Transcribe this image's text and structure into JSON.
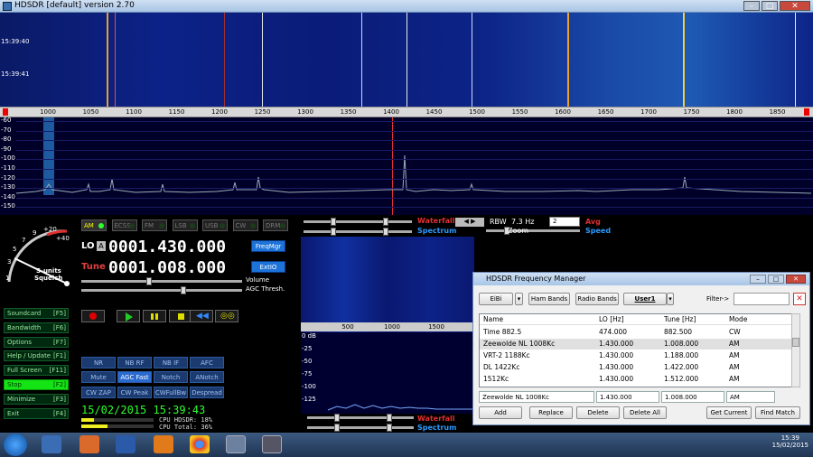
{
  "window": {
    "title": "HDSDR [default]  version 2.70"
  },
  "waterfall": {
    "times": [
      "15:39:40",
      "15:39:41"
    ]
  },
  "freq_scale": {
    "ticks": [
      "1000",
      "1050",
      "1100",
      "1150",
      "1200",
      "1250",
      "1300",
      "1350",
      "1400",
      "1450",
      "1500",
      "1550",
      "1600",
      "1650",
      "1700",
      "1750",
      "1800",
      "1850"
    ]
  },
  "spectrum": {
    "db_labels": [
      "-60",
      "-70",
      "-80",
      "-90",
      "-100",
      "-110",
      "-120",
      "-130",
      "-140",
      "-150"
    ]
  },
  "smeter": {
    "scale": [
      "1",
      "3",
      "5",
      "7",
      "9",
      "+20",
      "+40"
    ],
    "title": "S-units",
    "sub": "Squelch"
  },
  "modes": [
    {
      "label": "AM",
      "on": true
    },
    {
      "label": "ECSS",
      "on": false
    },
    {
      "label": "FM",
      "on": false
    },
    {
      "label": "LSB",
      "on": false
    },
    {
      "label": "USB",
      "on": false
    },
    {
      "label": "CW",
      "on": false
    },
    {
      "label": "DRM",
      "on": false
    }
  ],
  "lo": {
    "label": "LO",
    "badge": "A",
    "value": "0001.430.000"
  },
  "tune": {
    "label": "Tune",
    "value": "0001.008.000"
  },
  "buttons": {
    "freqmgr": "FreqMgr",
    "extio": "ExtIO"
  },
  "sliders": {
    "volume": "Volume",
    "agc": "AGC Thresh."
  },
  "side_buttons": [
    {
      "label": "Soundcard",
      "key": "[F5]"
    },
    {
      "label": "Bandwidth",
      "key": "[F6]"
    },
    {
      "label": "Options",
      "key": "[F7]"
    },
    {
      "label": "Help / Update",
      "key": "[F1]"
    },
    {
      "label": "Full Screen",
      "key": "[F11]"
    },
    {
      "label": "Stop",
      "key": "[F2]"
    },
    {
      "label": "Minimize",
      "key": "[F3]"
    },
    {
      "label": "Exit",
      "key": "[F4]"
    }
  ],
  "dsp_row1": [
    "NR",
    "NB RF",
    "NB IF",
    "AFC"
  ],
  "dsp_row2": [
    "Mute",
    "AGC Fast",
    "Notch",
    "ANotch"
  ],
  "dsp_row3": [
    "CW ZAP",
    "CW Peak",
    "CWFullBw",
    "Despread"
  ],
  "datetime": "15/02/2015 15:39:43",
  "cpu": {
    "hdsdr": "CPU HDSDR: 18%",
    "total": "CPU Total: 36%",
    "hdsdr_level": 0.18,
    "total_level": 0.36
  },
  "controls": {
    "waterfall": "Waterfall",
    "spectrum": "Spectrum",
    "rbw_label": "RBW",
    "rbw_value": "7.3 Hz",
    "zoom": "Zoom",
    "avg": "Avg",
    "speed": "Speed",
    "avg_value": "2"
  },
  "sub_scale": [
    "500",
    "1000",
    "1500"
  ],
  "sub_db": [
    "0 dB",
    "-25",
    "-50",
    "-75",
    "-100",
    "-125"
  ],
  "fm": {
    "title": "HDSDR Frequency Manager",
    "tabs": [
      "EiBi",
      "Ham Bands",
      "Radio Bands",
      "User1"
    ],
    "filter_label": "Filter->",
    "columns": [
      "Name",
      "LO [Hz]",
      "Tune [Hz]",
      "Mode"
    ],
    "rows": [
      [
        "Time 882.5",
        "474.000",
        "882.500",
        "CW"
      ],
      [
        "Zeewolde NL 1008Kc",
        "1.430.000",
        "1.008.000",
        "AM"
      ],
      [
        "VRT-2 1188Kc",
        "1.430.000",
        "1.188.000",
        "AM"
      ],
      [
        "DL 1422Kc",
        "1.430.000",
        "1.422.000",
        "AM"
      ],
      [
        "1512Kc",
        "1.430.000",
        "1.512.000",
        "AM"
      ]
    ],
    "edit": {
      "name": "Zeewolde NL 1008Kc",
      "lo": "1.430.000",
      "tune": "1.008.000",
      "mode": "AM"
    },
    "actions": [
      "Add",
      "Replace",
      "Delete",
      "Delete All",
      "Get Current",
      "Find Match"
    ]
  },
  "taskbar": {
    "time": "15:39",
    "date": "15/02/2015"
  }
}
